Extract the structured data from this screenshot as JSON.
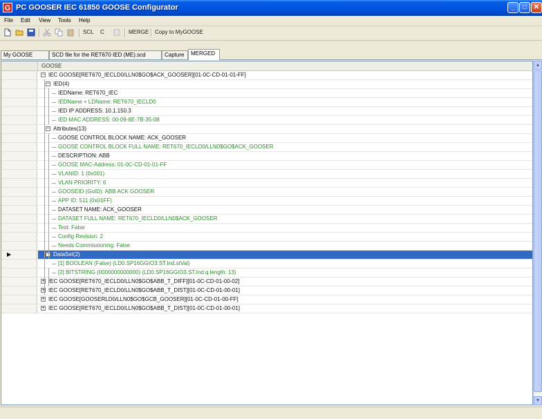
{
  "window": {
    "app_icon": "G",
    "title": "PC GOOSER   IEC 61850 GOOSE Configurator",
    "minimize": "_",
    "maximize": "□",
    "close": "✕"
  },
  "menu": [
    "File",
    "Edit",
    "View",
    "Tools",
    "Help"
  ],
  "toolbar": {
    "scl_label": "SCL",
    "c_label": "C",
    "merge_label": "MERGE",
    "copy_label": "Copy to MyGOOSE"
  },
  "tabs": [
    "My GOOSE",
    "SCD file for the RET670 IED (ME).scd",
    "Capture",
    "MERGED"
  ],
  "grid": {
    "column_header": "GOOSE",
    "rows": [
      {
        "text": "IEC GOOSE[RET670_IECLD0/LLN0$GO$ACK_GOOSER][01-0C-CD-01-01-FF]",
        "expander": "−"
      },
      {
        "text": "IED(4)",
        "expander": "−"
      },
      {
        "text": "IEDName: RET670_IEC"
      },
      {
        "text": "IEDName + LDName: RET670_IECLD0"
      },
      {
        "text": "IED IP ADDRESS: 10.1.150.3"
      },
      {
        "text": "IED MAC ADDRESS: 00-09-8E-7B-35-08"
      },
      {
        "text": "Attributes(13)",
        "expander": "−"
      },
      {
        "text": "GOOSE CONTROL BLOCK NAME: ACK_GOOSER"
      },
      {
        "text": "GOOSE CONTROL BLOCK FULL NAME: RET670_IECLD0/LLN0$GO$ACK_GOOSER"
      },
      {
        "text": "DESCRIPTION: ABB"
      },
      {
        "text": "GOOSE MAC-Address: 01-0C-CD-01-01-FF"
      },
      {
        "text": "VLANID: 1 (0x001)"
      },
      {
        "text": "VLAN PRIORITY: 6"
      },
      {
        "text": "GOOSEID (GoID): ABB ACK GOOSER"
      },
      {
        "text": "APP ID: 511 (0x01FF)"
      },
      {
        "text": "DATASET NAME: ACK_GOOSER"
      },
      {
        "text": "DATASET FULL NAME: RET670_IECLD0/LLN0$ACK_GOOSER"
      },
      {
        "text": "Test: False"
      },
      {
        "text": "Config Revision: 2"
      },
      {
        "text": "Needs Commissioning: False"
      },
      {
        "text": "DataSet(2)",
        "expander": "−"
      },
      {
        "text": "[1] BOOLEAN   (False)  (LD0.SP16GGIO3.ST.Ind.stVal)"
      },
      {
        "text": "[2] BITSTRING   (0000000000000)  (LD0.SP16GGIO3.ST.Ind.q length: 13)"
      },
      {
        "text": "IEC GOOSE[RET670_IECLD0/LLN0$GO$ABB_T_DIFF][01-0C-CD-01-00-02]",
        "expander": "+"
      },
      {
        "text": "IEC GOOSE[RET670_IECLD0/LLN0$GO$ABB_T_DIST][01-0C-CD-01-00-01]",
        "expander": "+"
      },
      {
        "text": "IEC GOOSE[GOOSERLD0/LLN0$GO$GCB_GOOSER][01-0C-CD-01-00-FF]",
        "expander": "+"
      },
      {
        "text": "IEC GOOSE[RET670_IECLD0/LLN0$GO$ABB_T_DIST][01-0C-CD-01-00-01]",
        "expander": "+"
      }
    ]
  },
  "colors": {
    "green_text": "#2e8b2e",
    "selection": "#316ac5",
    "titlebar": "#0054e3"
  }
}
